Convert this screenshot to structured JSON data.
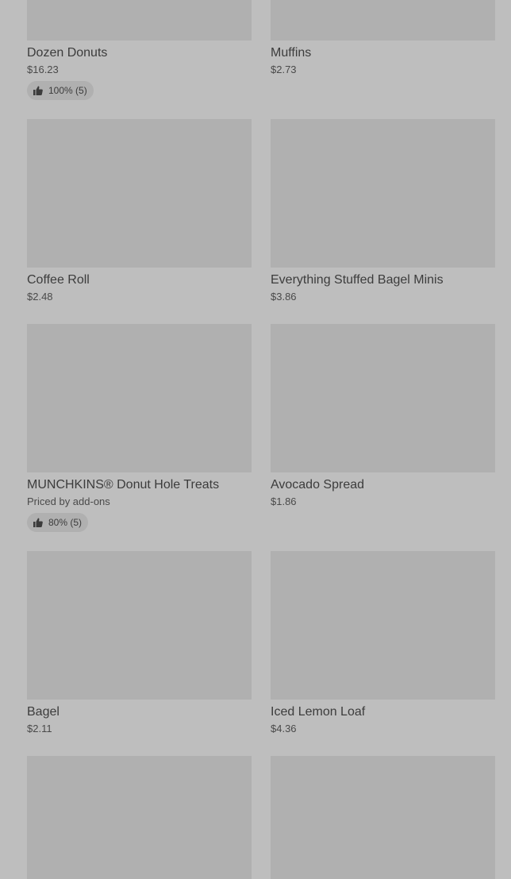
{
  "colors": {
    "background": "#bebebe",
    "image_placeholder": "#b0b0b0",
    "text": "#3c3c3c"
  },
  "items": [
    {
      "name": "Dozen Donuts",
      "price": "$16.23",
      "rating": "100% (5)",
      "icon": "thumbs-up-icon"
    },
    {
      "name": "Muffins",
      "price": "$2.73"
    },
    {
      "name": "Coffee Roll",
      "price": "$2.48"
    },
    {
      "name": "Everything Stuffed Bagel Minis",
      "price": "$3.86"
    },
    {
      "name": "MUNCHKINS® Donut Hole Treats",
      "price": "Priced by add-ons",
      "rating": "80% (5)",
      "icon": "thumbs-up-icon"
    },
    {
      "name": "Avocado Spread",
      "price": "$1.86"
    },
    {
      "name": "Bagel",
      "price": "$2.11"
    },
    {
      "name": "Iced Lemon Loaf",
      "price": "$4.36"
    }
  ]
}
